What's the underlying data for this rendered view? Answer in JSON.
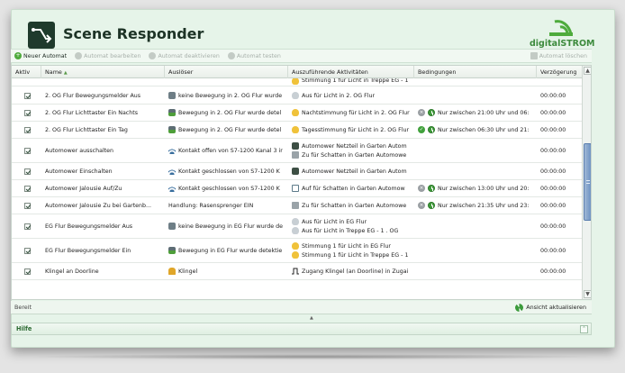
{
  "app": {
    "title": "Scene Responder",
    "logo_text": "digitalSTROM"
  },
  "toolbar": {
    "new": "Neuer Automat",
    "edit": "Automat bearbeiten",
    "deactivate": "Automat deaktivieren",
    "test": "Automat testen",
    "delete": "Automat löschen"
  },
  "columns": {
    "aktiv": "Aktiv",
    "name": "Name",
    "trigger": "Auslöser",
    "actions": "Auszuführende Aktivitäten",
    "conditions": "Bedingungen",
    "delay": "Verzögerung"
  },
  "top_partial_action": "Stimmung 1 für Licht in Treppe EG - 1",
  "rows": [
    {
      "name": "2. OG Flur Bewegungsmelder Aus",
      "trigger_icon": "motion-icon",
      "trigger": "keine Bewegung in 2. OG Flur wurde",
      "actions": [
        {
          "icon": "bulb-off-icon",
          "text": "Aus für Licht in 2. OG Flur"
        }
      ],
      "conditions": [],
      "delay": "00:00:00"
    },
    {
      "name": "2. OG Flur Lichttaster Ein Nachts",
      "trigger_icon": "motion-green-icon",
      "trigger": "Bewegung in 2. OG Flur wurde detel",
      "actions": [
        {
          "icon": "bulb-icon",
          "text": "Nachtstimmung für Licht in 2. OG Flur"
        }
      ],
      "conditions": [
        {
          "icon": "condition-x-icon",
          "text": ""
        },
        {
          "icon": "clock-icon",
          "text": "Nur zwischen 21:00 Uhr und 06:"
        }
      ],
      "delay": "00:00:00"
    },
    {
      "name": "2. OG Flur Lichttaster Ein Tag",
      "trigger_icon": "motion-green-icon",
      "trigger": "Bewegung in 2. OG Flur wurde detel",
      "actions": [
        {
          "icon": "bulb-icon",
          "text": "Tagesstimmung für Licht in 2. OG Flur"
        }
      ],
      "conditions": [
        {
          "icon": "condition-ok-icon",
          "text": ""
        },
        {
          "icon": "clock-icon",
          "text": "Nur zwischen 06:30 Uhr und 21:"
        }
      ],
      "delay": "00:00:00"
    },
    {
      "name": "Automower ausschalten",
      "trigger_icon": "sensor-icon",
      "trigger": "Kontakt offen von S7-1200 Kanal 3 ir",
      "actions": [
        {
          "icon": "plug-icon",
          "text": "Automower Netzteil in Garten Autom"
        },
        {
          "icon": "grey-icon",
          "text": "Zu für Schatten in Garten Automowe"
        }
      ],
      "conditions": [],
      "delay": "00:00:00"
    },
    {
      "name": "Automower Einschalten",
      "trigger_icon": "sensor-icon",
      "trigger": "Kontakt geschlossen von S7-1200 K",
      "actions": [
        {
          "icon": "plug-icon",
          "text": "Automower Netzteil in Garten Autom"
        }
      ],
      "conditions": [],
      "delay": "00:00:00"
    },
    {
      "name": "Automower Jalousie Auf/Zu",
      "trigger_icon": "sensor-icon",
      "trigger": "Kontakt geschlossen von S7-1200 K",
      "actions": [
        {
          "icon": "shade-icon",
          "text": "Auf für Schatten in Garten Automow"
        }
      ],
      "conditions": [
        {
          "icon": "condition-x-icon",
          "text": ""
        },
        {
          "icon": "clock-icon",
          "text": "Nur zwischen 13:00 Uhr und 20:"
        }
      ],
      "delay": "00:00:00"
    },
    {
      "name": "Automower Jalousie Zu bei Gartenb...",
      "trigger_icon": "",
      "trigger": "Handlung: Rasensprenger EIN",
      "actions": [
        {
          "icon": "grey-icon",
          "text": "Zu für Schatten in Garten Automowe"
        }
      ],
      "conditions": [
        {
          "icon": "condition-x-icon",
          "text": ""
        },
        {
          "icon": "clock-icon",
          "text": "Nur zwischen 21:35 Uhr und 23:"
        }
      ],
      "delay": "00:00:00"
    },
    {
      "name": "EG Flur Bewegungsmelder Aus",
      "trigger_icon": "motion-icon",
      "trigger": "keine Bewegung in EG Flur wurde de",
      "actions": [
        {
          "icon": "bulb-off-icon",
          "text": "Aus für Licht in EG Flur"
        },
        {
          "icon": "bulb-off-icon",
          "text": "Aus für Licht in Treppe EG - 1 . OG"
        }
      ],
      "conditions": [],
      "delay": "00:00:00"
    },
    {
      "name": "EG Flur Bewegungsmelder Ein",
      "trigger_icon": "motion-green-icon",
      "trigger": "Bewegung in EG Flur wurde detektie",
      "actions": [
        {
          "icon": "bulb-icon",
          "text": "Stimmung 1 für Licht in EG Flur"
        },
        {
          "icon": "bulb-icon",
          "text": "Stimmung 1 für Licht in Treppe EG - 1"
        }
      ],
      "conditions": [],
      "delay": "00:00:00"
    },
    {
      "name": "Klingel an Doorline",
      "trigger_icon": "bell-icon",
      "trigger": "Klingel",
      "actions": [
        {
          "icon": "pulse-icon",
          "text": "Zugang Klingel (an Doorline) in Zugai"
        }
      ],
      "conditions": [],
      "delay": "00:00:00"
    }
  ],
  "status": {
    "text": "Bereit",
    "refresh": "Ansicht aktualisieren"
  },
  "help": {
    "title": "Hilfe"
  },
  "colors": {
    "accent": "#4eab3c",
    "frame": "#e6f4e9",
    "scroll_thumb": "#6f93c3"
  }
}
